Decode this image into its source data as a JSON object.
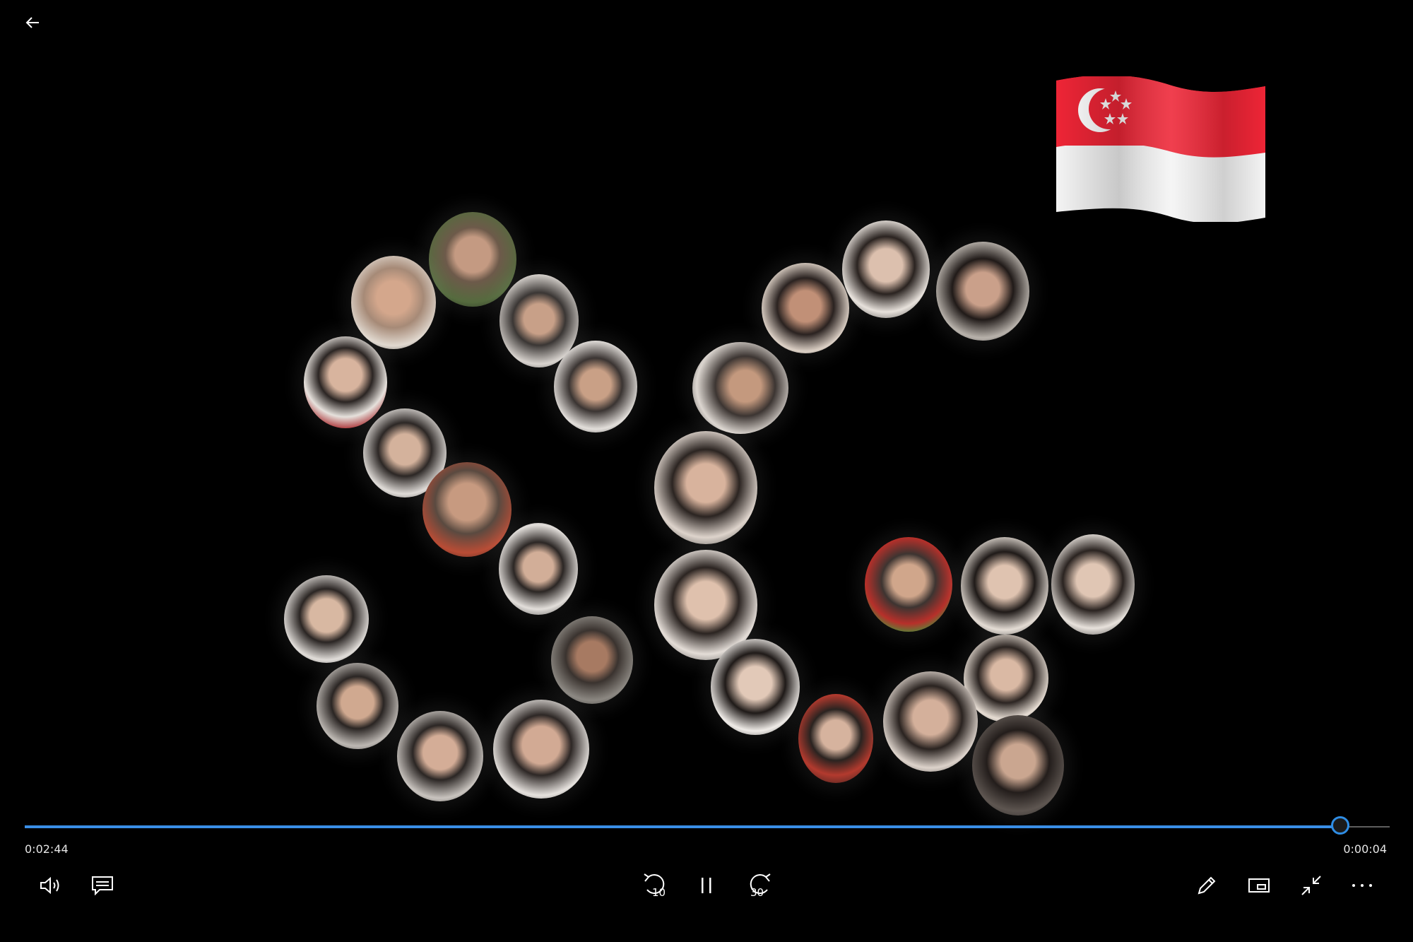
{
  "player": {
    "elapsed": "0:02:44",
    "remaining": "0:00:04",
    "progress": 0.964
  },
  "controls": {
    "skip_back_label": "10",
    "skip_forward_label": "30"
  },
  "colors": {
    "accent": "#2f8de4",
    "flag_red": "#ee2536",
    "flag_white": "#ffffff"
  },
  "icons": [
    "back-arrow-icon",
    "volume-icon",
    "captions-icon",
    "skip-back-10-icon",
    "pause-icon",
    "skip-forward-30-icon",
    "pen-icon",
    "mini-view-icon",
    "exit-fullscreen-icon",
    "more-icon"
  ]
}
